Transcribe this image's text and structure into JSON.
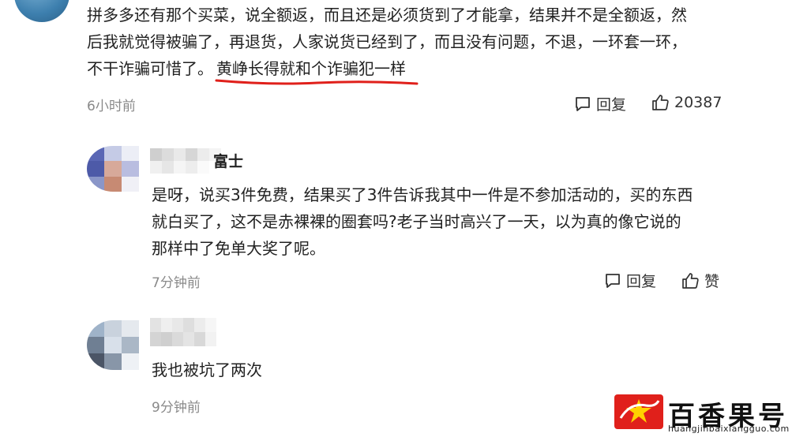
{
  "comment_main": {
    "lines": [
      "拼多多还有那个买菜，说全额返，而且还是必须货到了才能拿，结果并不是全额返，然",
      "后我就觉得被骗了，再退货，人家说货已经到了，而且没有问题，不退，一环套一环，",
      "不干诈骗可惜了。"
    ],
    "highlight": "黄峥长得就和个诈骗犯一样",
    "time": "6小时前",
    "reply_label": "回复",
    "like_count": "20387",
    "underline_color": "#e0201b"
  },
  "reply_1": {
    "name_suffix": "富士",
    "lines": [
      "是呀，说买3件免费，结果买了3件告诉我其中一件是不参加活动的，买的东西",
      "就白买了，这不是赤裸裸的圈套吗?老子当时高兴了一天，以为真的像它说的",
      "那样中了免单大奖了呢。"
    ],
    "time": "7分钟前",
    "reply_label": "回复",
    "like_label": "赞"
  },
  "reply_2": {
    "text": "我也被坑了两次",
    "time": "9分钟前"
  },
  "watermark": {
    "title": "百香果号",
    "url": "huangjinbaixiangguo.com",
    "brand_color": "#e0201b"
  }
}
